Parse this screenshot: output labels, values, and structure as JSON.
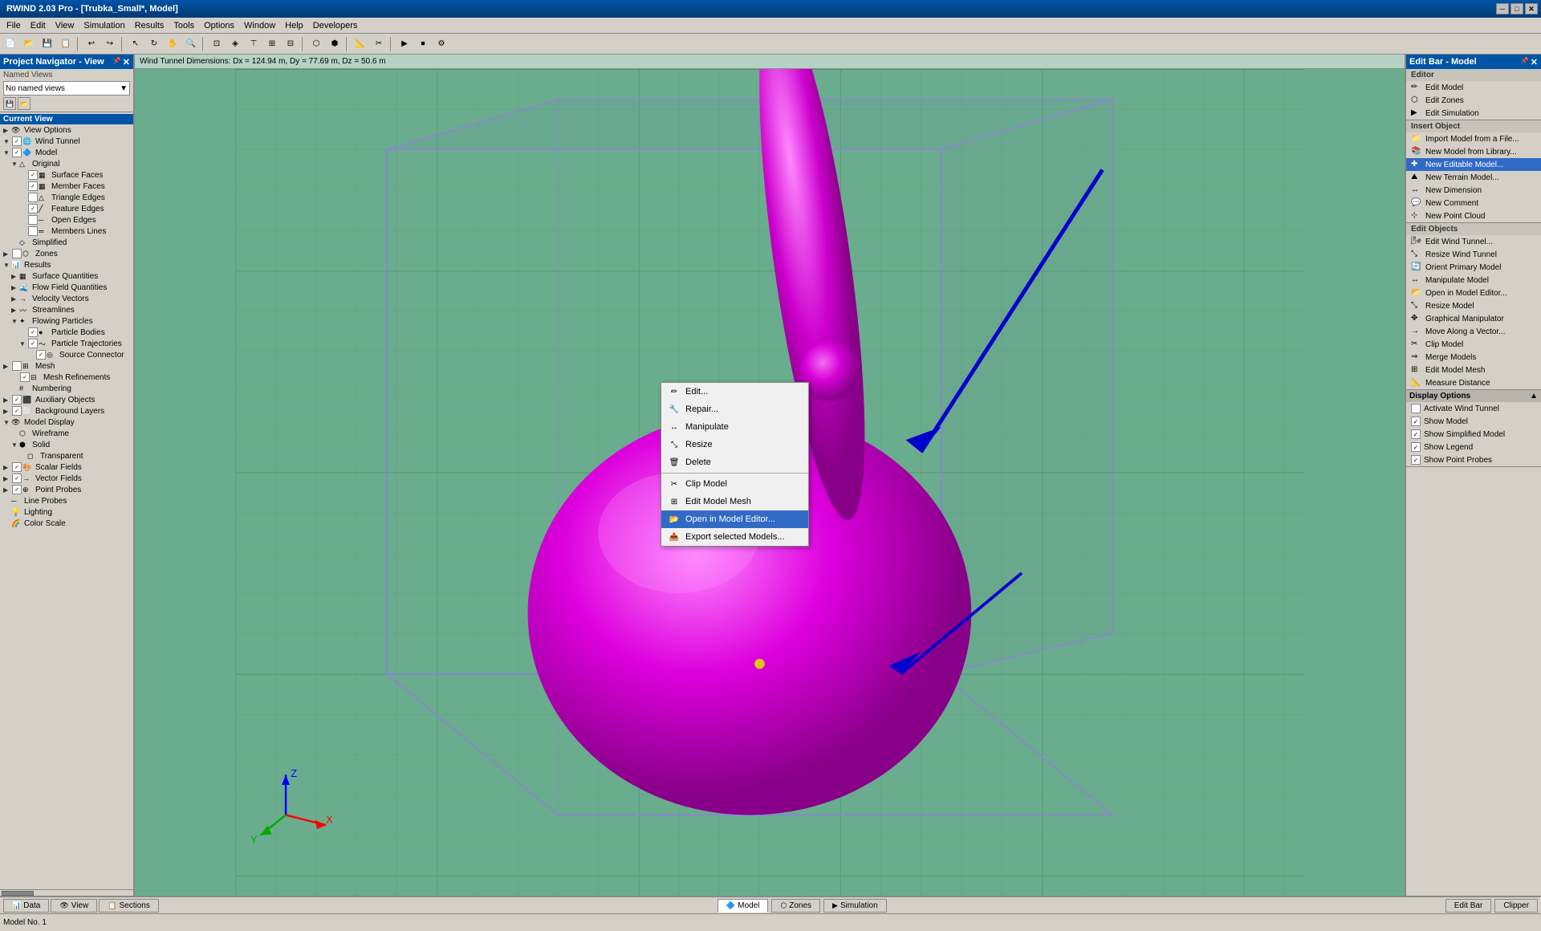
{
  "titleBar": {
    "title": "RWIND 2.03 Pro - [Trubka_Small*, Model]",
    "controls": [
      "minimize",
      "maximize",
      "close"
    ]
  },
  "menuBar": {
    "items": [
      "File",
      "Edit",
      "View",
      "Simulation",
      "Results",
      "Tools",
      "Options",
      "Window",
      "Help",
      "Developers"
    ]
  },
  "viewportInfo": "Wind Tunnel Dimensions: Dx = 124.94 m, Dy = 77.69 m, Dz = 50.6 m",
  "projectNav": {
    "title": "Project Navigator - View",
    "namedViews": {
      "label": "Named Views",
      "placeholder": "No named views"
    },
    "currentView": "Current View",
    "treeItems": [
      {
        "id": "view-options",
        "label": "View Options",
        "indent": 1,
        "hasArrow": true,
        "expanded": false
      },
      {
        "id": "wind-tunnel",
        "label": "Wind Tunnel",
        "indent": 1,
        "hasArrow": true,
        "expanded": true,
        "hasCheck": true,
        "checked": true
      },
      {
        "id": "model",
        "label": "Model",
        "indent": 1,
        "hasArrow": true,
        "expanded": true,
        "hasCheck": true,
        "checked": true
      },
      {
        "id": "original",
        "label": "Original",
        "indent": 2,
        "hasArrow": true,
        "expanded": true
      },
      {
        "id": "surface-faces",
        "label": "Surface Faces",
        "indent": 3,
        "hasCheck": true,
        "checked": true
      },
      {
        "id": "member-faces",
        "label": "Member Faces",
        "indent": 3,
        "hasCheck": true,
        "checked": true
      },
      {
        "id": "triangle-edges",
        "label": "Triangle Edges",
        "indent": 3,
        "hasCheck": true,
        "checked": false
      },
      {
        "id": "feature-edges",
        "label": "Feature Edges",
        "indent": 3,
        "hasCheck": true,
        "checked": true
      },
      {
        "id": "open-edges",
        "label": "Open Edges",
        "indent": 3,
        "hasCheck": true,
        "checked": false
      },
      {
        "id": "members-lines",
        "label": "Members Lines",
        "indent": 3,
        "hasCheck": true,
        "checked": false
      },
      {
        "id": "simplified",
        "label": "Simplified",
        "indent": 2,
        "hasArrow": false
      },
      {
        "id": "zones",
        "label": "Zones",
        "indent": 1,
        "hasArrow": true,
        "expanded": false,
        "hasCheck": true,
        "checked": false
      },
      {
        "id": "results",
        "label": "Results",
        "indent": 1,
        "hasArrow": true,
        "expanded": true
      },
      {
        "id": "surface-quantities",
        "label": "Surface Quantities",
        "indent": 2,
        "hasArrow": true
      },
      {
        "id": "flow-field-quantities",
        "label": "Flow Field Quantities",
        "indent": 2,
        "hasArrow": true
      },
      {
        "id": "velocity-vectors",
        "label": "Velocity Vectors",
        "indent": 2,
        "hasArrow": true
      },
      {
        "id": "streamlines",
        "label": "Streamlines",
        "indent": 2,
        "hasArrow": true
      },
      {
        "id": "flowing-particles",
        "label": "Flowing Particles",
        "indent": 2,
        "hasArrow": true
      },
      {
        "id": "particle-bodies",
        "label": "Particle Bodies",
        "indent": 3,
        "hasCheck": true,
        "checked": true
      },
      {
        "id": "particle-trajectories",
        "label": "Particle Trajectories",
        "indent": 3,
        "hasArrow": true
      },
      {
        "id": "source-connector",
        "label": "Source Connector",
        "indent": 4,
        "hasCheck": true,
        "checked": true
      },
      {
        "id": "mesh",
        "label": "Mesh",
        "indent": 1,
        "hasArrow": true,
        "hasCheck": true,
        "checked": false
      },
      {
        "id": "mesh-refinements",
        "label": "Mesh Refinements",
        "indent": 2,
        "hasCheck": true,
        "checked": true
      },
      {
        "id": "numbering",
        "label": "Numbering",
        "indent": 2
      },
      {
        "id": "auxiliary-objects",
        "label": "Auxiliary Objects",
        "indent": 1,
        "hasCheck": true,
        "checked": true
      },
      {
        "id": "background-layers",
        "label": "Background Layers",
        "indent": 1,
        "hasCheck": true,
        "checked": true
      },
      {
        "id": "model-display",
        "label": "Model Display",
        "indent": 1,
        "hasArrow": true,
        "expanded": true
      },
      {
        "id": "wireframe",
        "label": "Wireframe",
        "indent": 2,
        "hasArrow": false
      },
      {
        "id": "solid",
        "label": "Solid",
        "indent": 2,
        "hasArrow": true,
        "expanded": true
      },
      {
        "id": "transparent",
        "label": "Transparent",
        "indent": 3
      },
      {
        "id": "scalar-fields",
        "label": "Scalar Fields",
        "indent": 1,
        "hasCheck": true,
        "checked": true
      },
      {
        "id": "vector-fields",
        "label": "Vector Fields",
        "indent": 1,
        "hasCheck": true,
        "checked": true
      },
      {
        "id": "point-probes",
        "label": "Point Probes",
        "indent": 1,
        "hasCheck": true,
        "checked": true
      },
      {
        "id": "line-probes",
        "label": "Line Probes",
        "indent": 1
      },
      {
        "id": "lighting",
        "label": "Lighting",
        "indent": 1
      },
      {
        "id": "color-scale",
        "label": "Color Scale",
        "indent": 1
      }
    ]
  },
  "contextMenu": {
    "items": [
      {
        "id": "edit",
        "label": "Edit...",
        "icon": "edit"
      },
      {
        "id": "repair",
        "label": "Repair...",
        "icon": "repair"
      },
      {
        "id": "manipulate",
        "label": "Manipulate",
        "icon": "manipulate"
      },
      {
        "id": "resize",
        "label": "Resize",
        "icon": "resize"
      },
      {
        "id": "delete",
        "label": "Delete",
        "icon": "delete"
      },
      {
        "id": "clip-model",
        "label": "Clip Model",
        "icon": "clip"
      },
      {
        "id": "edit-model-mesh",
        "label": "Edit Model Mesh",
        "icon": "mesh"
      },
      {
        "id": "open-in-model-editor",
        "label": "Open in Model Editor...",
        "icon": "open",
        "active": true
      },
      {
        "id": "export-selected-models",
        "label": "Export selected Models...",
        "icon": "export"
      }
    ]
  },
  "rightPanel": {
    "title": "Edit Bar - Model",
    "editor": {
      "title": "Editor",
      "items": [
        {
          "id": "edit-model",
          "label": "Edit Model"
        },
        {
          "id": "edit-zones",
          "label": "Edit Zones"
        },
        {
          "id": "edit-simulation",
          "label": "Edit Simulation"
        }
      ]
    },
    "insertObject": {
      "title": "Insert Object",
      "items": [
        {
          "id": "import-model-from-file",
          "label": "Import Model from a File..."
        },
        {
          "id": "new-model-from-library",
          "label": "New Model from Library..."
        },
        {
          "id": "new-editable-model",
          "label": "New Editable Model...",
          "highlighted": true
        },
        {
          "id": "new-terrain-model",
          "label": "New Terrain Model..."
        },
        {
          "id": "new-dimension",
          "label": "New Dimension"
        },
        {
          "id": "new-comment",
          "label": "New Comment"
        },
        {
          "id": "new-point-cloud",
          "label": "New Point Cloud"
        }
      ]
    },
    "editObjects": {
      "title": "Edit Objects",
      "items": [
        {
          "id": "edit-wind-tunnel",
          "label": "Edit Wind Tunnel..."
        },
        {
          "id": "resize-wind-tunnel",
          "label": "Resize Wind Tunnel"
        },
        {
          "id": "orient-primary-model",
          "label": "Orient Primary Model"
        },
        {
          "id": "manipulate-model",
          "label": "Manipulate Model"
        },
        {
          "id": "open-in-model-editor",
          "label": "Open in Model Editor..."
        },
        {
          "id": "resize-model",
          "label": "Resize Model"
        },
        {
          "id": "graphical-manipulator",
          "label": "Graphical Manipulator"
        },
        {
          "id": "move-along-vector",
          "label": "Move Along a Vector..."
        },
        {
          "id": "clip-model",
          "label": "Clip Model"
        },
        {
          "id": "merge-models",
          "label": "Merge Models"
        },
        {
          "id": "edit-model-mesh",
          "label": "Edit Model Mesh"
        },
        {
          "id": "measure-distance",
          "label": "Measure Distance"
        }
      ]
    },
    "displayOptions": {
      "title": "Display Options",
      "items": [
        {
          "id": "activate-wind-tunnel",
          "label": "Activate Wind Tunnel",
          "hasCheck": true,
          "checked": false
        },
        {
          "id": "show-model",
          "label": "Show Model",
          "hasCheck": true,
          "checked": true
        },
        {
          "id": "show-simplified-model",
          "label": "Show Simplified Model",
          "hasCheck": true,
          "checked": true
        },
        {
          "id": "show-legend",
          "label": "Show Legend",
          "hasCheck": true,
          "checked": true
        },
        {
          "id": "show-point-probes",
          "label": "Show Point Probes",
          "hasCheck": true,
          "checked": true
        }
      ]
    }
  },
  "bottomTabs": {
    "left": [
      {
        "id": "data",
        "label": "Data",
        "icon": "data"
      },
      {
        "id": "view",
        "label": "View",
        "icon": "view"
      },
      {
        "id": "sections",
        "label": "Sections",
        "icon": "sections"
      }
    ],
    "right": [
      {
        "id": "edit-bar",
        "label": "Edit Bar"
      },
      {
        "id": "clipper",
        "label": "Clipper"
      }
    ],
    "centerTabs": [
      {
        "id": "model",
        "label": "Model",
        "active": true
      },
      {
        "id": "zones",
        "label": "Zones"
      },
      {
        "id": "simulation",
        "label": "Simulation"
      }
    ]
  },
  "statusBar": {
    "message": "Model No. 1"
  }
}
